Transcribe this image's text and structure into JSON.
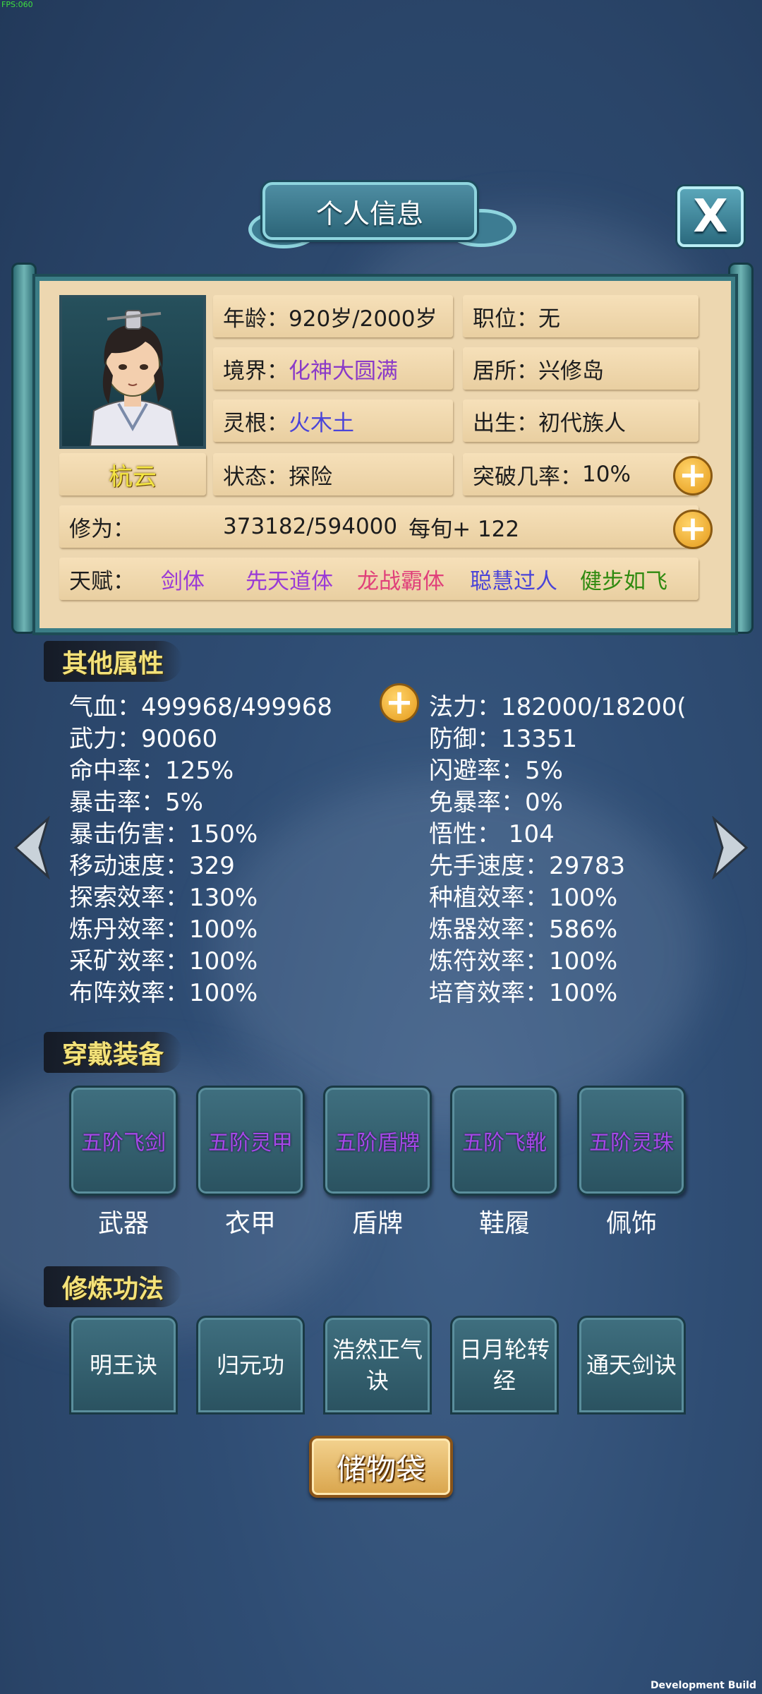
{
  "debug": {
    "fps": "FPS:060",
    "build_label": "Development Build"
  },
  "title": "个人信息",
  "close_label": "X",
  "profile": {
    "name": "杭云",
    "age": {
      "label": "年龄：",
      "value": "920岁/2000岁"
    },
    "position": {
      "label": "职位：",
      "value": "无"
    },
    "realm": {
      "label": "境界：",
      "value": "化神大圆满"
    },
    "residence": {
      "label": "居所：",
      "value": "兴修岛"
    },
    "spirit_root": {
      "label": "灵根：",
      "value": "火木土"
    },
    "origin": {
      "label": "出生：",
      "value": "初代族人"
    },
    "status": {
      "label": "状态：",
      "value": "探险"
    },
    "breakthrough": {
      "label": "突破几率：",
      "value": "10%"
    },
    "cultivation": {
      "label": "修为：",
      "value": "373182/594000",
      "rate": "每旬+ 122"
    },
    "talent": {
      "label": "天赋：",
      "items": [
        {
          "text": "剑体",
          "color": "#9a3bd6"
        },
        {
          "text": "先天道体",
          "color": "#9a3bd6"
        },
        {
          "text": "龙战霸体",
          "color": "#e0407a"
        },
        {
          "text": "聪慧过人",
          "color": "#4a44d8"
        },
        {
          "text": "健步如飞",
          "color": "#2f8a10"
        }
      ]
    }
  },
  "sections": {
    "other_attributes": "其他属性",
    "equipment": "穿戴装备",
    "techniques": "修炼功法"
  },
  "attributes_left": [
    "气血：499968/499968",
    "武力：90060",
    "命中率：125%",
    "暴击率：5%",
    "暴击伤害：150%",
    "移动速度：329",
    "探索效率：130%",
    "炼丹效率：100%",
    "采矿效率：100%",
    "布阵效率：100%"
  ],
  "attributes_right": [
    "法力：182000/18200(",
    "防御：13351",
    "闪避率：5%",
    "免暴率：0%",
    "悟性： 104",
    "先手速度：29783",
    "种植效率：100%",
    "炼器效率：586%",
    "炼符效率：100%",
    "培育效率：100%"
  ],
  "equipment": [
    {
      "item": "五阶飞剑",
      "slot": "武器"
    },
    {
      "item": "五阶灵甲",
      "slot": "衣甲"
    },
    {
      "item": "五阶盾牌",
      "slot": "盾牌"
    },
    {
      "item": "五阶飞靴",
      "slot": "鞋履"
    },
    {
      "item": "五阶灵珠",
      "slot": "佩饰"
    }
  ],
  "techniques": [
    "明王诀",
    "归元功",
    "浩然正气诀",
    "日月轮转经",
    "通天剑诀"
  ],
  "storage_bag": "储物袋",
  "colors": {
    "accent_gold": "#f3e27a",
    "panel": "#edd7b0",
    "purple": "#8a3ac8",
    "blue": "#4a44d8"
  }
}
